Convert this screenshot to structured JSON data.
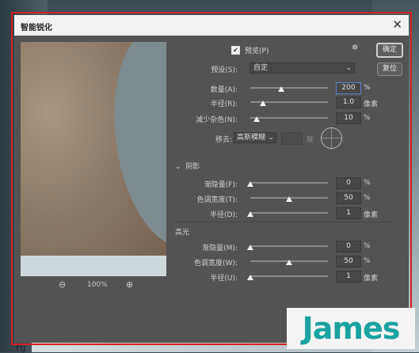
{
  "window": {
    "title": "智能锐化",
    "close_glyph": "✕"
  },
  "preview_pane": {
    "zoom_out_glyph": "⊖",
    "zoom_level": "100%",
    "zoom_in_glyph": "⊕"
  },
  "options": {
    "preview_label": "预览(P)",
    "preview_checked": true,
    "checkbox_glyph": "✔",
    "gear_glyph": "✲",
    "ok_label": "确定",
    "reset_label": "复位",
    "preset_label": "预设(S):",
    "preset_value": "自定",
    "chevron": "⌄",
    "amount": {
      "label": "数量(A):",
      "value": "200",
      "unit": "%",
      "level": 0.4
    },
    "radius": {
      "label": "半径(R):",
      "value": "1.0",
      "unit": "像素",
      "level": 0.16
    },
    "noise": {
      "label": "减少杂色(N):",
      "value": "10",
      "unit": "%",
      "level": 0.08
    },
    "remove": {
      "label": "移去:",
      "value": "高斯模糊",
      "deg_unit": "度"
    }
  },
  "shadows": {
    "section_label": "阴影",
    "collapse_glyph": "⌄",
    "fade": {
      "label": "渐隐量(F):",
      "value": "0",
      "unit": "%",
      "level": 0.0
    },
    "tonal": {
      "label": "色调宽度(T):",
      "value": "50",
      "unit": "%",
      "level": 0.5
    },
    "radius": {
      "label": "半径(D):",
      "value": "1",
      "unit": "像素",
      "level": 0.0
    }
  },
  "highlights": {
    "section_label": "高光",
    "fade": {
      "label": "渐隐量(M):",
      "value": "0",
      "unit": "%",
      "level": 0.0
    },
    "tonal": {
      "label": "色调宽度(W):",
      "value": "50",
      "unit": "%",
      "level": 0.5
    },
    "radius": {
      "label": "半径(U):",
      "value": "1",
      "unit": "像素",
      "level": 0.0
    }
  },
  "watermark": {
    "text": "James"
  },
  "background_text": "HJ"
}
